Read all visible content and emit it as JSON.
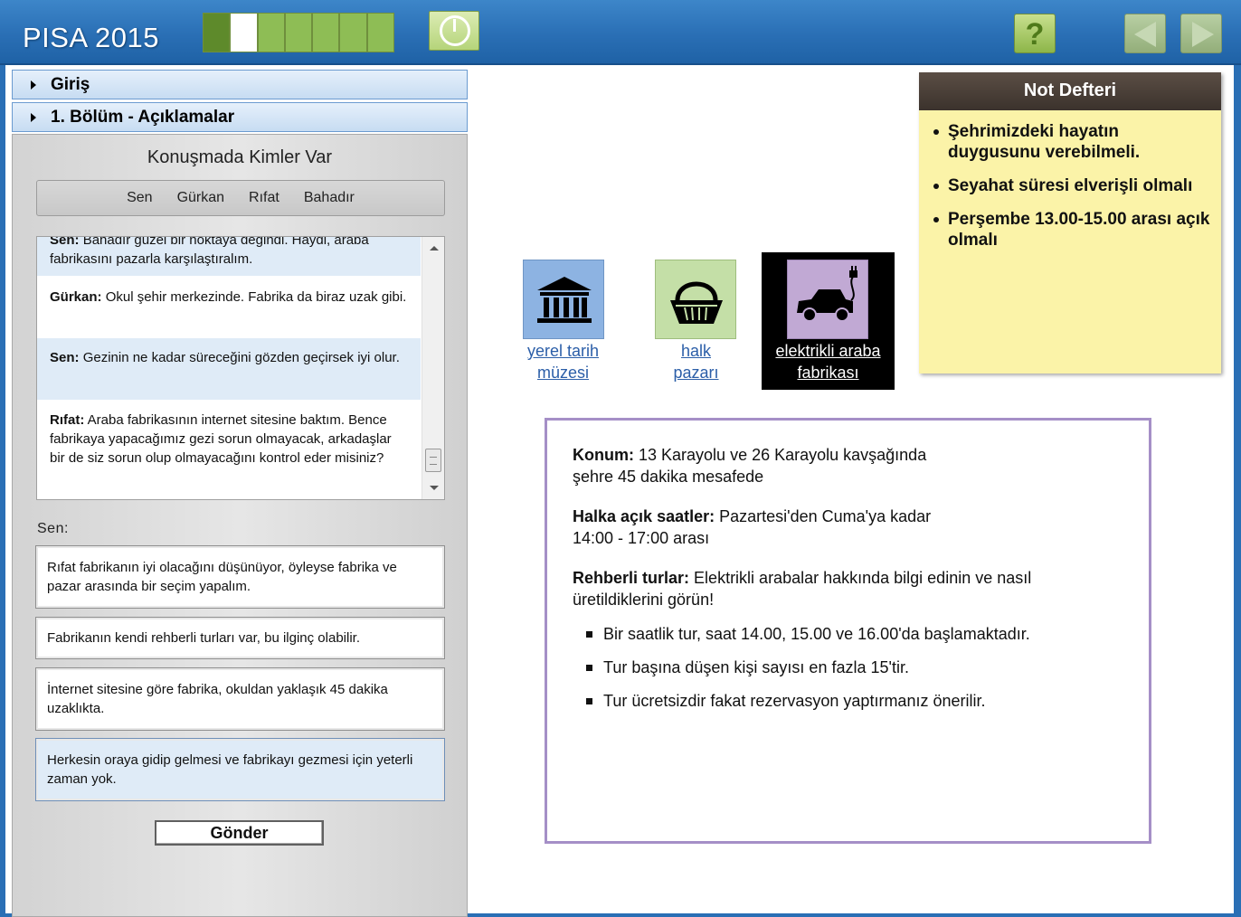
{
  "app": {
    "title": "PISA 2015"
  },
  "progress": {
    "segments": 7,
    "completed": 1,
    "current_index": 1
  },
  "toolbar": {
    "help_label": "?"
  },
  "sections": [
    {
      "label": "Giriş"
    },
    {
      "label": "1. Bölüm - Açıklamalar"
    }
  ],
  "conversation": {
    "title": "Konuşmada Kimler Var",
    "participants": [
      "Sen",
      "Gürkan",
      "Rıfat",
      "Bahadır"
    ],
    "messages": [
      {
        "speaker": "Sen:",
        "text": "Bahadır güzel bir noktaya değindi. Haydi, araba fabrikasını pazarla karşılaştıralım."
      },
      {
        "speaker": "Gürkan:",
        "text": "Okul şehir merkezinde. Fabrika da biraz uzak gibi."
      },
      {
        "speaker": "Sen:",
        "text": "Gezinin ne kadar süreceğini gözden geçirsek iyi olur."
      },
      {
        "speaker": "Rıfat:",
        "text": "Araba fabrikasının internet sitesine baktım. Bence fabrikaya yapacağımız gezi sorun olmayacak, arkadaşlar bir de siz sorun olup olmayacağını kontrol eder misiniz?"
      }
    ],
    "response_label": "Sen:",
    "options": [
      "Rıfat fabrikanın iyi olacağını düşünüyor, öyleyse fabrika ve pazar arasında bir seçim yapalım.",
      "Fabrikanın kendi rehberli turları var, bu ilginç olabilir.",
      "İnternet sitesine göre fabrika, okuldan yaklaşık 45 dakika uzaklıkta.",
      "Herkesin oraya gidip gelmesi ve fabrikayı gezmesi için yeterli zaman yok."
    ],
    "selected_option": 3,
    "submit_label": "Gönder"
  },
  "notebook": {
    "title": "Not Defteri",
    "items": [
      "Şehrimizdeki hayatın duygusunu verebilmeli.",
      "Seyahat süresi elverişli olmalı",
      "Perşembe 13.00-15.00 arası açık olmalı"
    ]
  },
  "places": [
    {
      "line1": "yerel tarih",
      "line2": "müzesi",
      "icon": "museum-icon",
      "color": "#8db3e2"
    },
    {
      "line1": "halk",
      "line2": "pazarı",
      "icon": "basket-icon",
      "color": "#c4dfa7"
    },
    {
      "line1": "elektrikli araba",
      "line2": "fabrikası",
      "icon": "electric-car-icon",
      "color": "#c1a9d4",
      "active": true
    }
  ],
  "info": {
    "location_label": "Konum:",
    "location_text": "13 Karayolu ve 26 Karayolu kavşağında",
    "location_text2": "şehre 45 dakika mesafede",
    "hours_label": "Halka açık saatler:",
    "hours_text": "Pazartesi'den Cuma'ya kadar",
    "hours_text2": "14:00 - 17:00 arası",
    "tours_label": "Rehberli turlar:",
    "tours_text": "Elektrikli arabalar hakkında bilgi edinin ve nasıl",
    "tours_text2": "üretildiklerini görün!",
    "bullets": [
      "Bir saatlik tur, saat 14.00, 15.00 ve 16.00'da başlamaktadır.",
      "Tur başına düşen kişi sayısı en fazla 15'tir.",
      "Tur ücretsizdir fakat rezervasyon yaptırmanız önerilir."
    ]
  }
}
